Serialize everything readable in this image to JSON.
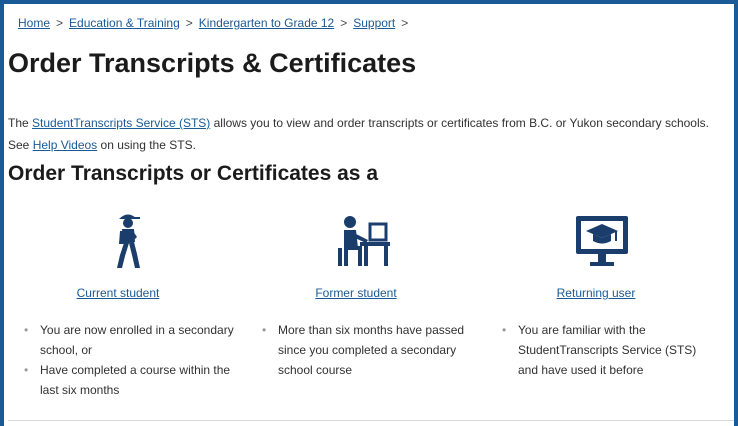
{
  "breadcrumb": [
    {
      "label": "Home"
    },
    {
      "label": "Education & Training"
    },
    {
      "label": "Kindergarten to Grade 12"
    },
    {
      "label": "Support"
    }
  ],
  "breadcrumb_separator": ">",
  "page_title": "Order Transcripts & Certificates",
  "intro": {
    "text1": "The ",
    "sts_link": "StudentTranscripts Service (STS)",
    "text2": " allows you to view and order transcripts or certificates from B.C. or Yukon secondary schools.  See ",
    "help_link": "Help Videos",
    "text3": " on using the STS."
  },
  "section_title": "Order Transcripts or Certificates as a",
  "options": [
    {
      "icon": "walking-student-icon",
      "link": "Current student",
      "bullets": [
        "You are now enrolled in a secondary school, or",
        "Have completed a course within the last six months"
      ]
    },
    {
      "icon": "person-at-desk-icon",
      "link": "Former student",
      "bullets": [
        "More than six months have passed since you completed a secondary school course"
      ]
    },
    {
      "icon": "graduation-monitor-icon",
      "link": "Returning user",
      "bullets": [
        "You are familiar with the StudentTranscripts Service (STS) and have used it before"
      ]
    }
  ],
  "colors": {
    "frame": "#1a5a96",
    "link": "#1a5a96",
    "icon": "#1a3d6b",
    "text": "#313132"
  }
}
